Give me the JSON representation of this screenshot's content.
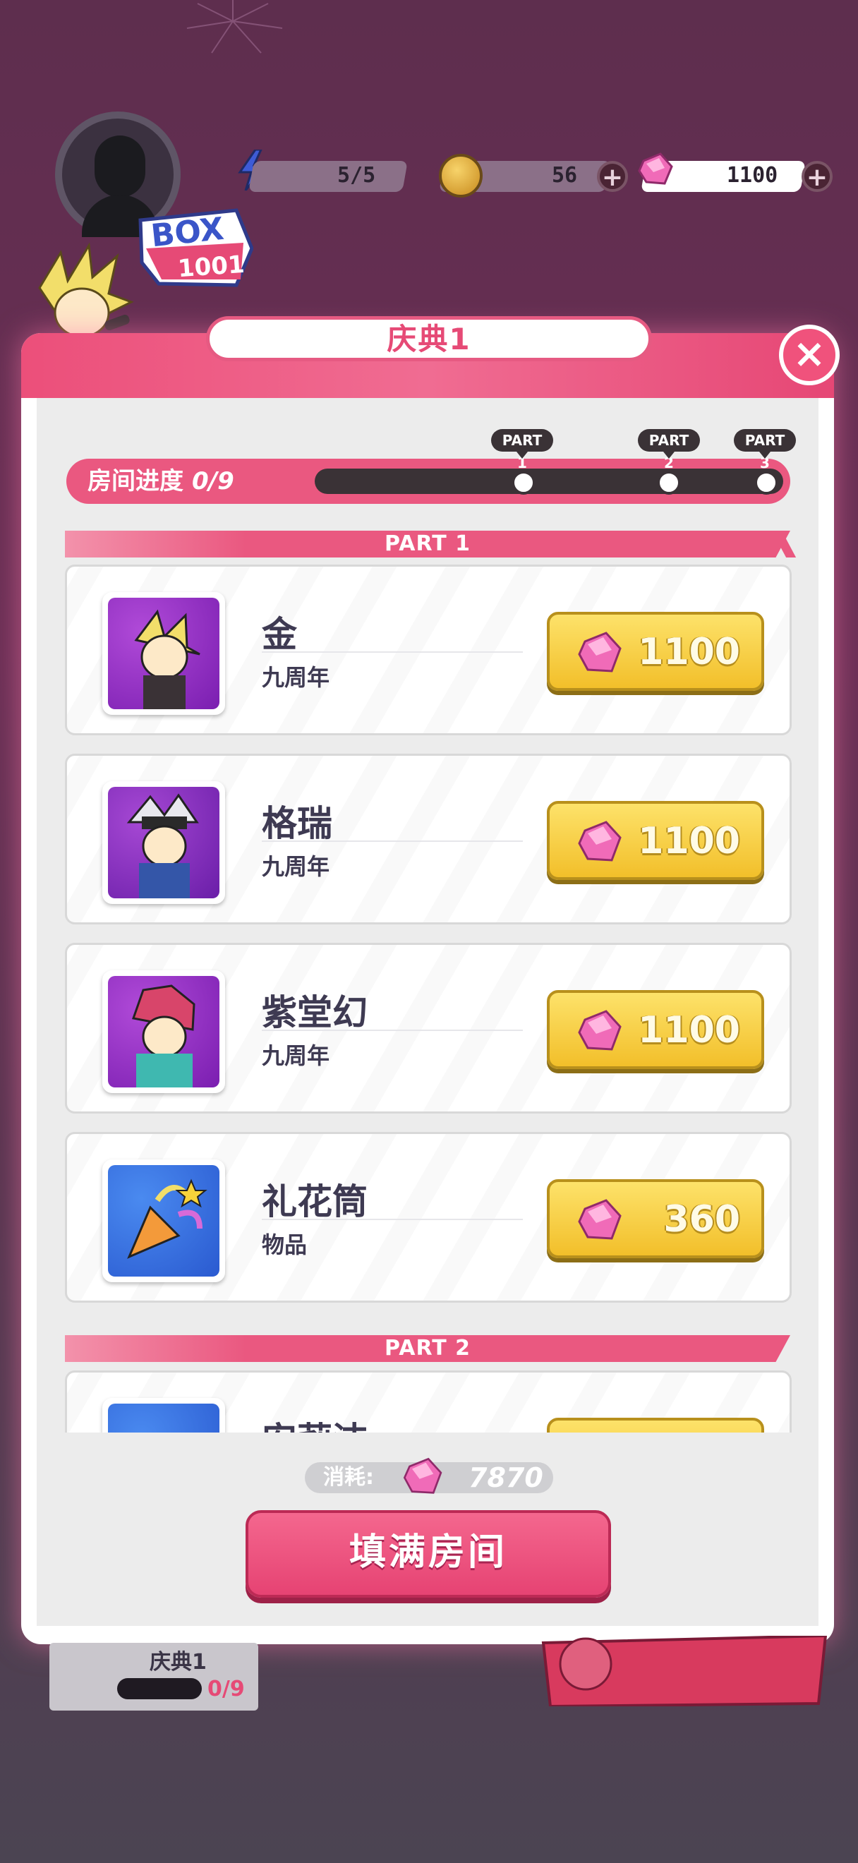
{
  "hud": {
    "energy": "5/5",
    "coins": "56",
    "gems": "1100"
  },
  "badge": {
    "line1": "BOX",
    "line2": "1001"
  },
  "dialog": {
    "title": "庆典1",
    "progress_label": "房间进度",
    "progress_value": "0/9",
    "progress": 0,
    "part_tags": [
      "PART 1",
      "PART 2",
      "PART 3"
    ]
  },
  "sections": [
    {
      "title": "PART 1",
      "items": [
        {
          "name": "金",
          "sub": "九周年",
          "price": "1100"
        },
        {
          "name": "格瑞",
          "sub": "九周年",
          "price": "1100"
        },
        {
          "name": "紫堂幻",
          "sub": "九周年",
          "price": "1100"
        },
        {
          "name": "礼花筒",
          "sub": "物品",
          "price": "360"
        }
      ]
    },
    {
      "title": "PART 2",
      "items": [
        {
          "name": "安莉洁",
          "sub": "",
          "price": ""
        }
      ]
    }
  ],
  "footer": {
    "cost_label": "消耗:",
    "cost_value": "7870",
    "fill_button": "填满房间"
  },
  "background": {
    "room_label": "庆典1",
    "room_count": "0/9"
  },
  "colors": {
    "accent_pink": "#ea5880",
    "button_yellow": "#f7cf3e",
    "dark": "#3a3236"
  }
}
